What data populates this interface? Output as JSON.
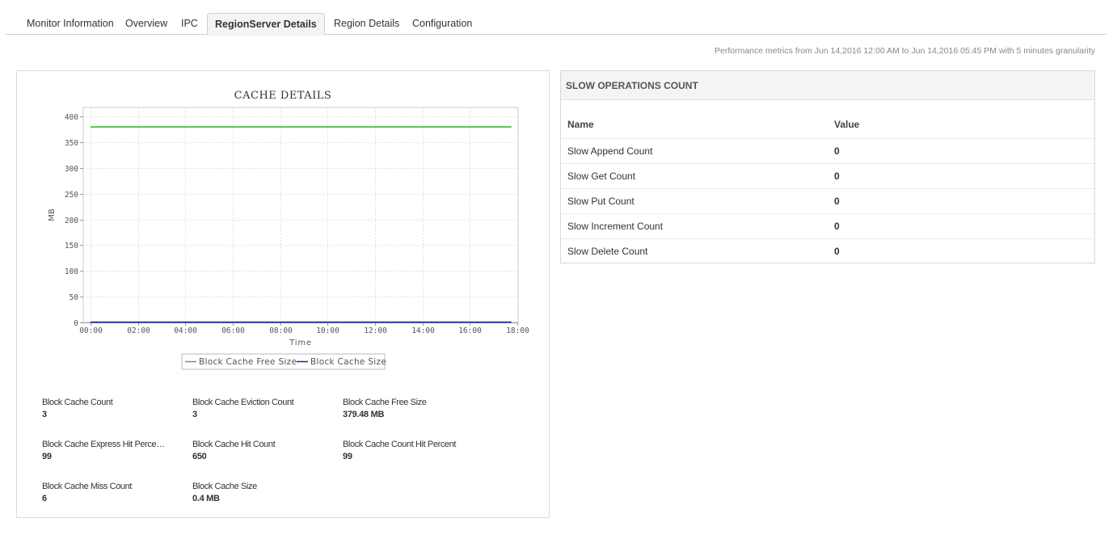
{
  "tabs": [
    {
      "label": "Monitor Information",
      "active": false
    },
    {
      "label": "Overview",
      "active": false
    },
    {
      "label": "IPC",
      "active": false
    },
    {
      "label": "RegionServer Details",
      "active": true
    },
    {
      "label": "Region Details",
      "active": false
    },
    {
      "label": "Configuration",
      "active": false
    }
  ],
  "perf_note": "Performance metrics from Jun 14,2016 12:00 AM to Jun 14,2016 05:45 PM with 5 minutes granularity",
  "chart_data": {
    "type": "line",
    "title": "CACHE DETAILS",
    "xlabel": "Time",
    "ylabel": "MB",
    "x_ticks": [
      "00:00",
      "02:00",
      "04:00",
      "06:00",
      "08:00",
      "10:00",
      "12:00",
      "14:00",
      "16:00",
      "18:00"
    ],
    "y_ticks": [
      0,
      50,
      100,
      150,
      200,
      250,
      300,
      350,
      400
    ],
    "xlim": [
      "00:00",
      "18:00"
    ],
    "ylim": [
      0,
      400
    ],
    "grid": true,
    "legend_position": "bottom",
    "series": [
      {
        "name": "Block Cache Free Size",
        "color": "#33bb33",
        "x": [
          "00:00",
          "17:45"
        ],
        "values": [
          379.48,
          379.48
        ]
      },
      {
        "name": "Block Cache Size",
        "color": "#2222aa",
        "x": [
          "00:00",
          "17:45"
        ],
        "values": [
          0.4,
          0.4
        ]
      }
    ]
  },
  "cache_stats": [
    {
      "label": "Block Cache Count",
      "value": "3"
    },
    {
      "label": "Block Cache Eviction Count",
      "value": "3"
    },
    {
      "label": "Block Cache Free Size",
      "value": "379.48 MB"
    },
    {
      "label": "Block Cache Express Hit Perce…",
      "value": "99"
    },
    {
      "label": "Block Cache Hit Count",
      "value": "650"
    },
    {
      "label": "Block Cache Count Hit Percent",
      "value": "99"
    },
    {
      "label": "Block Cache Miss Count",
      "value": "6"
    },
    {
      "label": "Block Cache Size",
      "value": "0.4 MB"
    }
  ],
  "slow_ops": {
    "title": "SLOW OPERATIONS COUNT",
    "col_name": "Name",
    "col_value": "Value",
    "rows": [
      {
        "name": "Slow Append Count",
        "value": "0"
      },
      {
        "name": "Slow Get Count",
        "value": "0"
      },
      {
        "name": "Slow Put Count",
        "value": "0"
      },
      {
        "name": "Slow Increment Count",
        "value": "0"
      },
      {
        "name": "Slow Delete Count",
        "value": "0"
      }
    ]
  }
}
